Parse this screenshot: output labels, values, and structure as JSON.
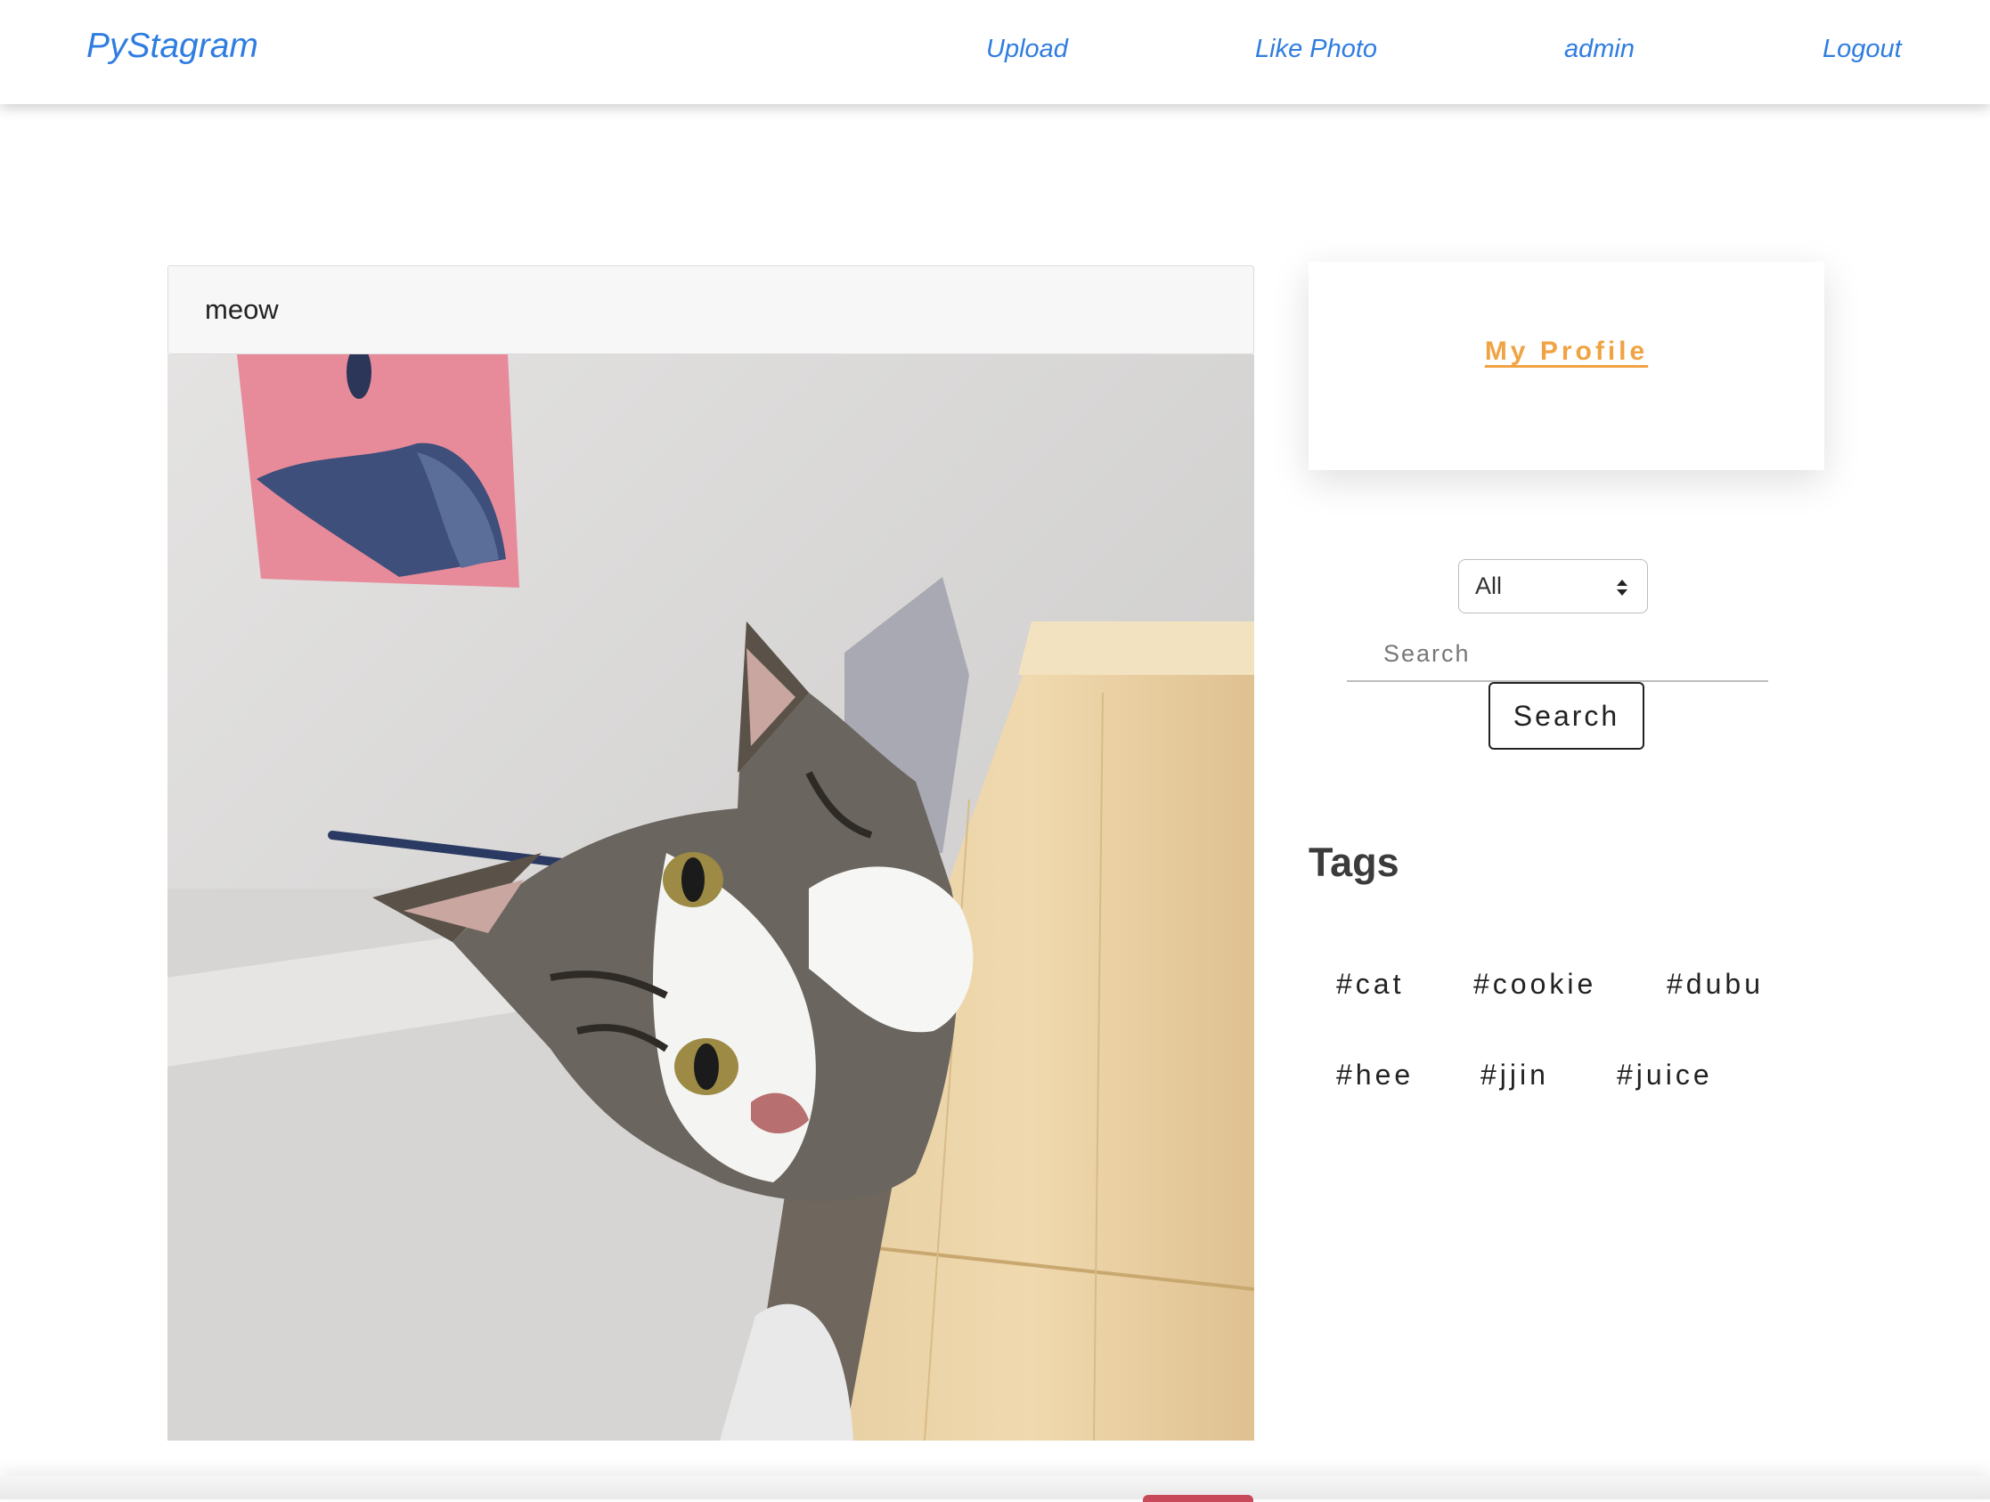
{
  "navbar": {
    "brand": "PyStagram",
    "links": [
      "Upload",
      "Like Photo",
      "admin",
      "Logout"
    ]
  },
  "post": {
    "caption": "meow",
    "photo_alt": "tabby cat leaning on wooden shelf"
  },
  "sidebar": {
    "profile_link": "My Profile",
    "filter_selected": "All",
    "search_placeholder": "Search",
    "search_button": "Search",
    "tags_heading": "Tags",
    "tags": [
      "#cat",
      "#cookie",
      "#dubu",
      "#hee",
      "#jjin",
      "#juice"
    ]
  },
  "colors": {
    "link": "#2f7de1",
    "profile_accent": "#f0a343"
  }
}
